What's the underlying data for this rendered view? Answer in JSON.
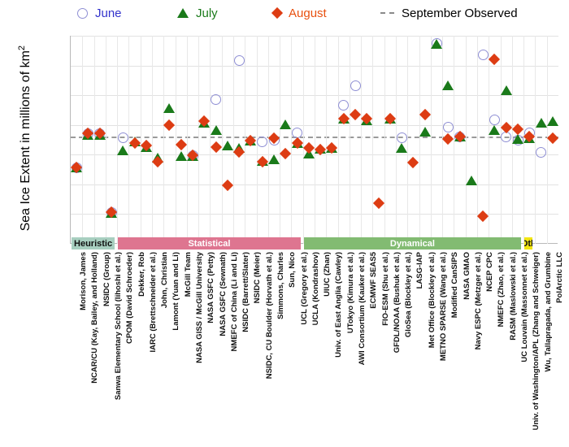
{
  "chart_data": {
    "type": "scatter",
    "title": "",
    "xlabel": "",
    "ylabel": "Sea Ice Extent in millions of km",
    "ylabel_superscript": "2",
    "ylim": [
      2.5,
      6
    ],
    "yticks": [
      6,
      5.5,
      5,
      4.5,
      4,
      3.5,
      3,
      2.5
    ],
    "grid": true,
    "legend_position": "top",
    "september_observed": 4.31,
    "legend": [
      {
        "name": "June",
        "marker": "open-circle",
        "color": "#8f8fd4",
        "text_color": "#3333cc"
      },
      {
        "name": "July",
        "marker": "filled-triangle",
        "color": "#1a7a1a",
        "text_color": "#1a7a1a"
      },
      {
        "name": "August",
        "marker": "filled-diamond",
        "color": "#dd3c13",
        "text_color": "#e8500f"
      },
      {
        "name": "September Observed",
        "marker": "dashed-line",
        "color": "#9a9a9a",
        "text_color": "#000000"
      }
    ],
    "groups": [
      {
        "label": "Heuristic",
        "color": "#a8cfc0",
        "start": 0,
        "end": 3
      },
      {
        "label": "Statistical",
        "color": "#de7590",
        "start": 4,
        "end": 19
      },
      {
        "label": "Dynamical",
        "color": "#82bb72",
        "start": 20,
        "end": 38
      },
      {
        "label": "Oth",
        "color": "#f2e511",
        "start": 39,
        "end": 39
      }
    ],
    "categories": [
      "Morison, James",
      "NCAR/CU (Kay, Bailey, and Holland)",
      "NSIDC (Group)",
      "Sanwa Elementary School (Iihoshi et al.)",
      "CPOM (David Schroeder)",
      "Dekker, Rob",
      "IARC (Brettschneider et al.)",
      "John, Christian",
      "Lamont (Yuan and Li)",
      "McGill Team",
      "NASA GISS / McGill University",
      "NASA GSFC (Petty)",
      "NASA GSFC (Sewnath)",
      "NMEFC of China (Li and Li)",
      "NSIDC (Barrett/Slater)",
      "NSIDC (Meier)",
      "NSIDC, CU Boulder (Horvath et al.)",
      "Simmons, Charles",
      "Sun, Nico",
      "UCL (Gregory et al.)",
      "UCLA (Kondrashov)",
      "UIUC (Zhan)",
      "Univ. of East Anglia (Cawley)",
      "UTokyo (Kimura et al.)",
      "AWI Consortium (Kauker et al.)",
      "ECMWF SEAS5",
      "FIO-ESM (Shu et al.)",
      "GFDL/NOAA (Bushuk et al.)",
      "GloSea (Blockley et al.)",
      "LASG-IAP",
      "Met Office (Blockley et al.)",
      "METNO SPARSE (Wang et al.)",
      "Modified CanSIPS",
      "NASA GMAO",
      "Navy ESPC (Metzger et al.)",
      "NCEP CPC",
      "NMEFC (Zhao, et al.)",
      "RASM (Maslowski et al.)",
      "UC Louvain (Massonnet et al.)",
      "Univ. of Washington/APL (Zhang and Schweiger)",
      "Wu, Tallapragada, and Grumbine",
      "PolArctic LLC"
    ],
    "series": [
      {
        "name": "June",
        "marker": "open-circle",
        "values": [
          3.78,
          4.35,
          4.35,
          3.03,
          4.28,
          null,
          null,
          null,
          null,
          null,
          3.98,
          null,
          4.93,
          null,
          5.58,
          null,
          4.21,
          4.25,
          null,
          4.36,
          null,
          null,
          null,
          4.83,
          5.16,
          null,
          null,
          null,
          4.28,
          null,
          null,
          5.87,
          4.46,
          4.3,
          null,
          5.68,
          4.59,
          4.3,
          4.25,
          4.37,
          4.04,
          null
        ]
      },
      {
        "name": "July",
        "marker": "filled-triangle",
        "values": [
          3.78,
          4.33,
          4.33,
          3.02,
          4.07,
          4.22,
          4.13,
          3.95,
          4.78,
          3.97,
          3.98,
          4.54,
          4.42,
          4.15,
          4.11,
          4.24,
          3.9,
          3.92,
          4.51,
          4.2,
          4.02,
          4.1,
          4.11,
          4.6,
          null,
          4.58,
          null,
          4.61,
          4.11,
          null,
          4.38,
          5.87,
          5.17,
          4.3,
          3.57,
          null,
          4.42,
          5.08,
          4.27,
          4.28,
          4.54,
          4.57
        ]
      },
      {
        "name": "August",
        "marker": "filled-diamond",
        "values": [
          3.79,
          4.36,
          4.36,
          3.04,
          null,
          4.2,
          4.15,
          3.88,
          4.49,
          4.17,
          3.99,
          4.56,
          4.13,
          3.49,
          4.05,
          4.24,
          3.88,
          4.28,
          4.02,
          4.19,
          4.11,
          4.08,
          4.12,
          4.61,
          4.67,
          4.6,
          3.19,
          4.61,
          null,
          3.87,
          4.67,
          null,
          4.26,
          4.3,
          null,
          2.97,
          5.6,
          4.46,
          4.43,
          4.3,
          null,
          4.28
        ]
      }
    ]
  },
  "axis": {
    "y_title_main": "Sea Ice Extent in millions of km",
    "y_title_sup": "2"
  }
}
